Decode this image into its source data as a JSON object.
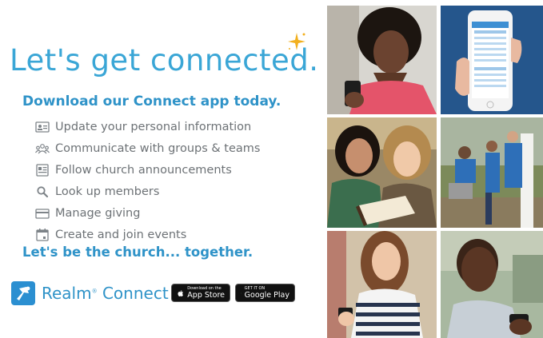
{
  "headline": "Let's get connected.",
  "subhead": "Download our Connect app today.",
  "features": [
    {
      "icon": "id-card-icon",
      "label": "Update your personal information"
    },
    {
      "icon": "group-icon",
      "label": "Communicate with groups & teams"
    },
    {
      "icon": "announcement-icon",
      "label": "Follow church announcements"
    },
    {
      "icon": "search-icon",
      "label": "Look up members"
    },
    {
      "icon": "credit-card-icon",
      "label": "Manage giving"
    },
    {
      "icon": "calendar-icon",
      "label": "Create and join events"
    }
  ],
  "tagline": "Let's be the church... together.",
  "brand": {
    "name": "Realm",
    "reg": "®",
    "suffix": " Connect"
  },
  "app_store": {
    "small": "Download on the",
    "big": "App Store"
  },
  "google_play": {
    "small": "GET IT ON",
    "big": "Google Play"
  },
  "colors": {
    "accent": "#3aa6d6",
    "heading": "#2f93c8",
    "text": "#6d7276",
    "sparkle": "#f2b01e"
  }
}
